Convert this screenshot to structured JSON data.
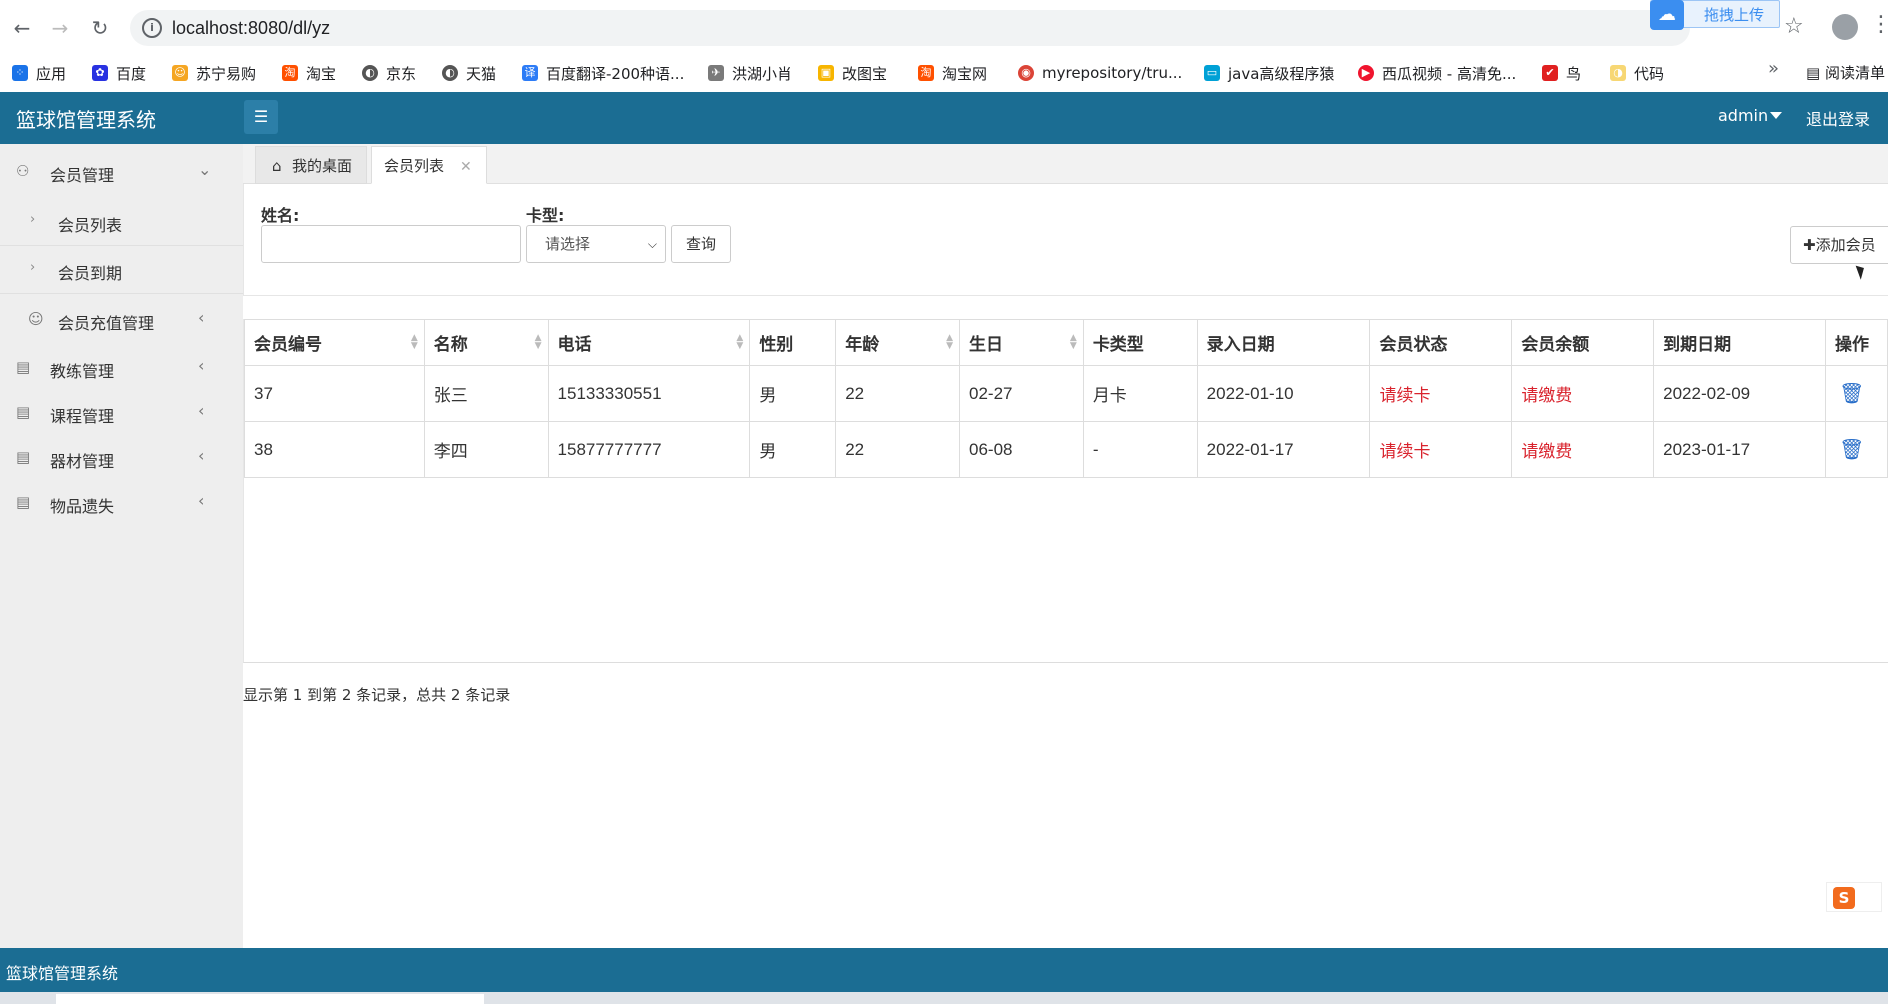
{
  "browser": {
    "url": "localhost:8080/dl/yz",
    "upload_popup": "拖拽上传",
    "bookmarks": [
      {
        "label": "应用",
        "color": "#1a73e8"
      },
      {
        "label": "百度",
        "color": "#2932e1"
      },
      {
        "label": "苏宁易购",
        "color": "#f5a623"
      },
      {
        "label": "淘宝",
        "color": "#ff5000"
      },
      {
        "label": "京东",
        "color": "#555555"
      },
      {
        "label": "天猫",
        "color": "#555555"
      },
      {
        "label": "百度翻译-200种语...",
        "color": "#2d7cf6"
      },
      {
        "label": "洪湖小肖",
        "color": "#7a7a7a"
      },
      {
        "label": "改图宝",
        "color": "#f7b500"
      },
      {
        "label": "淘宝网",
        "color": "#ff5000"
      },
      {
        "label": "myrepository/tru...",
        "color": "#db4437"
      },
      {
        "label": "java高级程序猿",
        "color": "#00a1d6"
      },
      {
        "label": "西瓜视频 - 高清免...",
        "color": "#f0142e"
      },
      {
        "label": "鸟",
        "color": "#e02020"
      },
      {
        "label": "代码",
        "color": "#f7d774"
      }
    ],
    "reading_list": "阅读清单"
  },
  "header": {
    "title": "篮球馆管理系统",
    "user": "admin",
    "logout": "退出登录"
  },
  "sidebar": {
    "items": [
      {
        "label": "会员管理"
      },
      {
        "label": "会员列表"
      },
      {
        "label": "会员到期"
      },
      {
        "label": "会员充值管理"
      },
      {
        "label": "教练管理"
      },
      {
        "label": "课程管理"
      },
      {
        "label": "器材管理"
      },
      {
        "label": "物品遗失"
      }
    ]
  },
  "tabs": [
    {
      "label": "我的桌面"
    },
    {
      "label": "会员列表"
    }
  ],
  "search": {
    "name_label": "姓名:",
    "name_value": "",
    "card_label": "卡型:",
    "card_selected": "请选择",
    "query_button": "查询",
    "add_button": "添加会员"
  },
  "table": {
    "columns": [
      "会员编号",
      "名称",
      "电话",
      "性别",
      "年龄",
      "生日",
      "卡类型",
      "录入日期",
      "会员状态",
      "会员余额",
      "到期日期",
      "操作"
    ],
    "rows": [
      [
        "37",
        "张三",
        "15133330551",
        "男",
        "22",
        "02-27",
        "月卡",
        "2022-01-10",
        "请续卡",
        "请缴费",
        "2022-02-09"
      ],
      [
        "38",
        "李四",
        "15877777777",
        "男",
        "22",
        "06-08",
        "-",
        "2022-01-17",
        "请续卡",
        "请缴费",
        "2023-01-17"
      ]
    ]
  },
  "summary": "显示第 1 到第 2 条记录，总共 2 条记录",
  "footer": "篮球馆管理系统",
  "colors": {
    "brand": "#1b6d93",
    "status_red": "#d9232d",
    "action_blue": "#2a6fc9"
  }
}
